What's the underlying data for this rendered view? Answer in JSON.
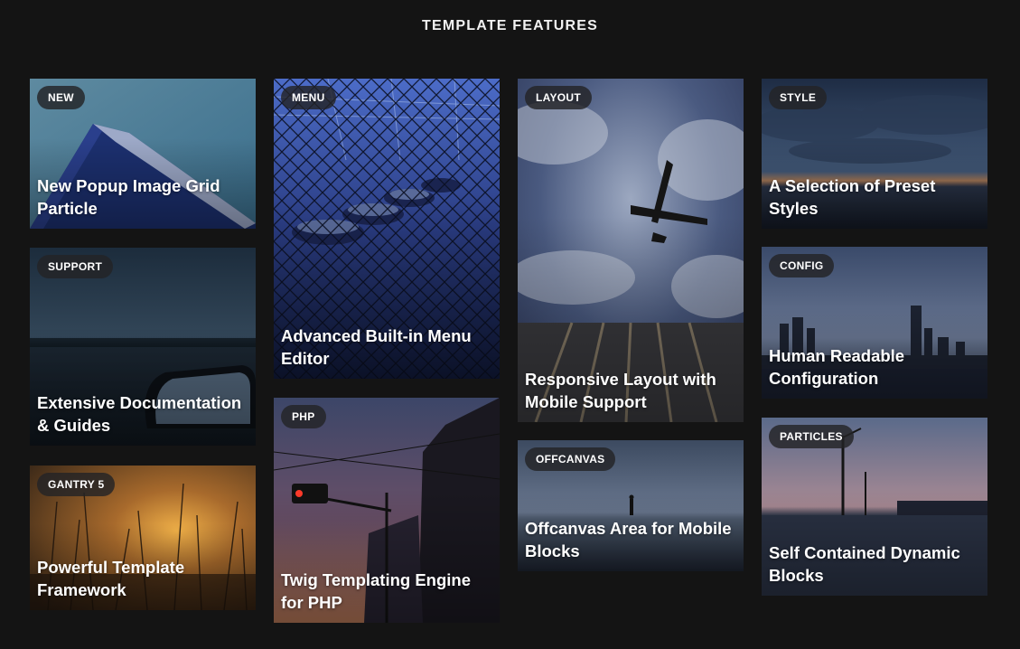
{
  "header": {
    "title": "TEMPLATE FEATURES"
  },
  "cards": [
    {
      "badge": "NEW",
      "title": "New Popup Image Grid Particle",
      "image": "building-sky-image"
    },
    {
      "badge": "SUPPORT",
      "title": "Extensive Documentation & Guides",
      "image": "lake-car-mirror-image"
    },
    {
      "badge": "GANTRY 5",
      "title": "Powerful Template Framework",
      "image": "sunset-grass-image"
    },
    {
      "badge": "MENU",
      "title": "Advanced Built-in Menu Editor",
      "image": "bumper-cars-image"
    },
    {
      "badge": "PHP",
      "title": "Twig Templating Engine for PHP",
      "image": "traffic-light-dusk-image"
    },
    {
      "badge": "LAYOUT",
      "title": "Responsive Layout with Mobile Support",
      "image": "airplane-skyscraper-image"
    },
    {
      "badge": "OFFCANVAS",
      "title": "Offcanvas Area for Mobile Blocks",
      "image": "person-sea-shore-image"
    },
    {
      "badge": "STYLE",
      "title": "A Selection of Preset Styles",
      "image": "cloudy-sunset-sea-image"
    },
    {
      "badge": "CONFIG",
      "title": "Human Readable Configuration",
      "image": "city-skyline-image"
    },
    {
      "badge": "PARTICLES",
      "title": "Self Contained Dynamic Blocks",
      "image": "road-power-lines-image"
    }
  ]
}
